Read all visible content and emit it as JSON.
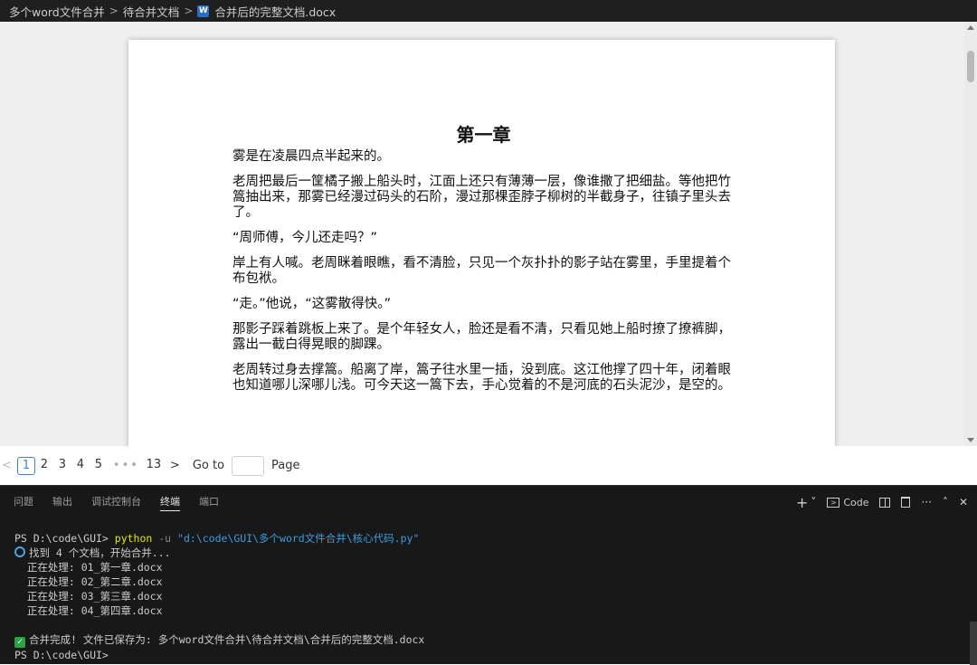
{
  "breadcrumb": {
    "items": [
      "多个word文件合并",
      "待合并文档"
    ],
    "file": "合并后的完整文档.docx",
    "sep": ">",
    "file_icon": "W"
  },
  "document": {
    "title": "第一章",
    "paragraphs": [
      "雾是在凌晨四点半起来的。",
      "老周把最后一筐橘子搬上船头时，江面上还只有薄薄一层，像谁撒了把细盐。等他把竹篙抽出来，那雾已经漫过码头的石阶，漫过那棵歪脖子柳树的半截身子，往镇子里头去了。",
      "“周师傅，今儿还走吗？”",
      "岸上有人喊。老周眯着眼瞧，看不清脸，只见一个灰扑扑的影子站在雾里，手里提着个布包袱。",
      "“走。”他说，“这雾散得快。”",
      "那影子踩着跳板上来了。是个年轻女人，脸还是看不清，只看见她上船时撩了撩裤脚，露出一截白得晃眼的脚踝。",
      "老周转过身去撑篙。船离了岸，篙子往水里一插，没到底。这江他撑了四十年，闭着眼也知道哪儿深哪儿浅。可今天这一篙下去，手心觉着的不是河底的石头泥沙，是空的。"
    ]
  },
  "pager": {
    "prev": "<",
    "pages": [
      "1",
      "2",
      "3",
      "4",
      "5"
    ],
    "dots": "•••",
    "last": "13",
    "next": ">",
    "current": "1",
    "goto_label": "Go to",
    "goto_value": "",
    "page_label": "Page"
  },
  "panel": {
    "tabs": [
      "问题",
      "输出",
      "调试控制台",
      "终端",
      "端口"
    ],
    "active_tab": "终端",
    "actions": {
      "add": "+",
      "dropdown": "˅",
      "terminal_label": "Code",
      "more": "···",
      "maximize": "˄",
      "close": "✕"
    },
    "terminal": {
      "prompt1": "PS D:\\code\\GUI> ",
      "cmd": "python",
      "flag": " -u ",
      "script": "\"d:\\code\\GUI\\多个word文件合并\\核心代码.py\"",
      "found": "找到 4 个文档，开始合并...",
      "processing": [
        "  正在处理: 01_第一章.docx",
        "  正在处理: 02_第二章.docx",
        "  正在处理: 03_第三章.docx",
        "  正在处理: 04_第四章.docx"
      ],
      "done": "合并完成! 文件已保存为: 多个word文件合并\\待合并文档\\合并后的完整文档.docx",
      "prompt2": "PS D:\\code\\GUI> "
    }
  }
}
